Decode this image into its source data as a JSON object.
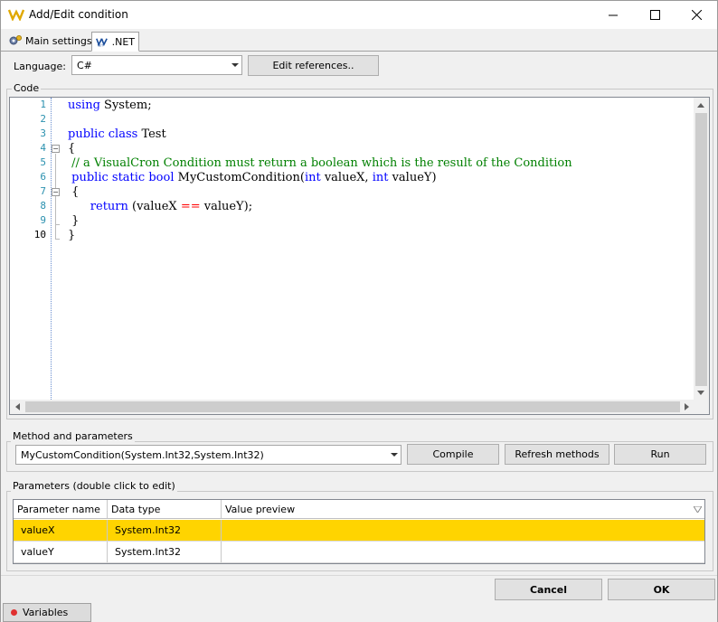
{
  "window": {
    "title": "Add/Edit condition"
  },
  "tabs": [
    {
      "label": "Main settings",
      "icon": "settings-gear-icon"
    },
    {
      "label": ".NET",
      "icon": "dotnet-logo-icon",
      "active": true
    }
  ],
  "language": {
    "label": "Language:",
    "value": "C#",
    "edit_references_label": "Edit references.."
  },
  "code_group": {
    "title": "Code",
    "line_numbers": [
      "1",
      "2",
      "3",
      "4",
      "5",
      "6",
      "7",
      "8",
      "9",
      "10"
    ],
    "lines": [
      [
        {
          "t": "using",
          "c": "kw"
        },
        {
          "t": " System;",
          "c": ""
        }
      ],
      [],
      [
        {
          "t": "public",
          "c": "kw"
        },
        {
          "t": " ",
          "c": ""
        },
        {
          "t": "class",
          "c": "kw"
        },
        {
          "t": " Test",
          "c": ""
        }
      ],
      [
        {
          "t": "{",
          "c": ""
        }
      ],
      [
        {
          "t": " // a VisualCron Condition must return a boolean which is the result of the Condition",
          "c": "cm"
        }
      ],
      [
        {
          "t": " ",
          "c": ""
        },
        {
          "t": "public",
          "c": "kw"
        },
        {
          "t": " ",
          "c": ""
        },
        {
          "t": "static",
          "c": "kw"
        },
        {
          "t": " ",
          "c": ""
        },
        {
          "t": "bool",
          "c": "kw"
        },
        {
          "t": " MyCustomCondition(",
          "c": ""
        },
        {
          "t": "int",
          "c": "kw"
        },
        {
          "t": " valueX, ",
          "c": ""
        },
        {
          "t": "int",
          "c": "kw"
        },
        {
          "t": " valueY)",
          "c": ""
        }
      ],
      [
        {
          "t": " {",
          "c": ""
        }
      ],
      [
        {
          "t": "      ",
          "c": ""
        },
        {
          "t": "return",
          "c": "kw"
        },
        {
          "t": " (valueX ",
          "c": ""
        },
        {
          "t": "==",
          "c": "op"
        },
        {
          "t": " valueY);",
          "c": ""
        }
      ],
      [
        {
          "t": " }",
          "c": ""
        }
      ],
      [
        {
          "t": "}",
          "c": ""
        }
      ]
    ]
  },
  "method_group": {
    "title": "Method and parameters",
    "method_value": "MyCustomCondition(System.Int32,System.Int32)",
    "compile_label": "Compile",
    "refresh_label": "Refresh methods",
    "run_label": "Run"
  },
  "params_group": {
    "title": "Parameters (double click to edit)",
    "columns": [
      "Parameter name",
      "Data type",
      "Value preview"
    ],
    "rows": [
      {
        "name": "valueX",
        "type": "System.Int32",
        "preview": "",
        "selected": true
      },
      {
        "name": "valueY",
        "type": "System.Int32",
        "preview": "",
        "selected": false
      }
    ]
  },
  "footer": {
    "cancel_label": "Cancel",
    "ok_label": "OK"
  },
  "statusbar": {
    "variables_label": "Variables"
  }
}
